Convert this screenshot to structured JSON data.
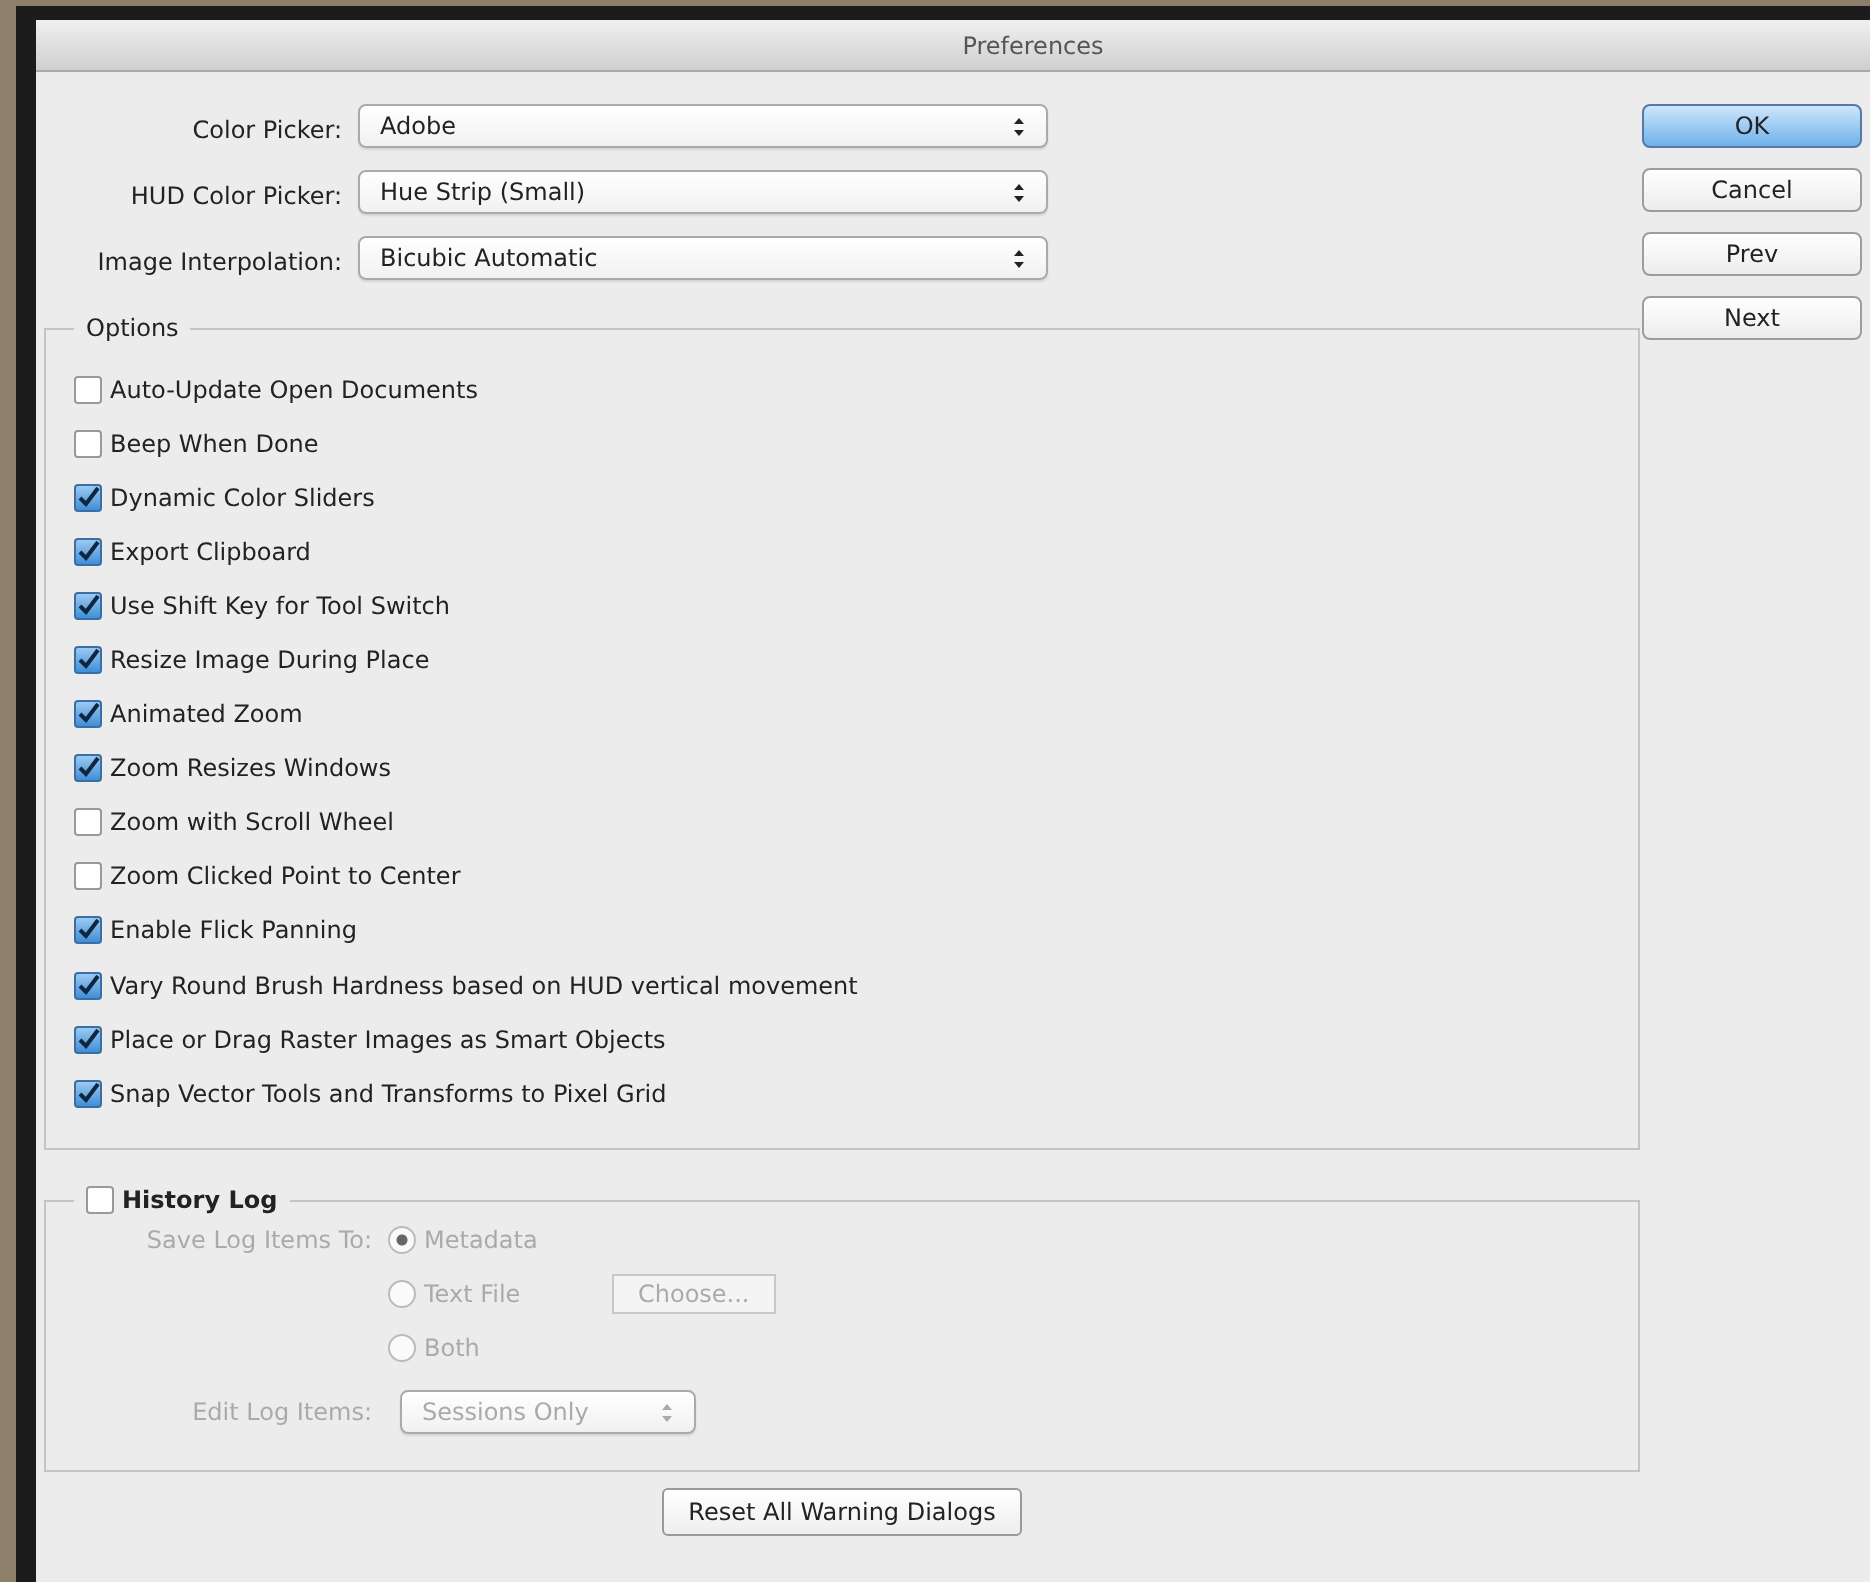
{
  "window": {
    "title": "Preferences"
  },
  "general": [
    {
      "label": "Color Picker:",
      "value": "Adobe"
    },
    {
      "label": "HUD Color Picker:",
      "value": "Hue Strip (Small)"
    },
    {
      "label": "Image Interpolation:",
      "value": "Bicubic Automatic"
    }
  ],
  "options": {
    "title": "Options",
    "items": [
      {
        "label": "Auto-Update Open Documents",
        "checked": false
      },
      {
        "label": "Beep When Done",
        "checked": false
      },
      {
        "label": "Dynamic Color Sliders",
        "checked": true
      },
      {
        "label": "Export Clipboard",
        "checked": true
      },
      {
        "label": "Use Shift Key for Tool Switch",
        "checked": true
      },
      {
        "label": "Resize Image During Place",
        "checked": true
      },
      {
        "label": "Animated Zoom",
        "checked": true
      },
      {
        "label": "Zoom Resizes Windows",
        "checked": true
      },
      {
        "label": "Zoom with Scroll Wheel",
        "checked": false
      },
      {
        "label": "Zoom Clicked Point to Center",
        "checked": false
      },
      {
        "label": "Enable Flick Panning",
        "checked": true
      },
      {
        "label": "Vary Round Brush Hardness based on HUD vertical movement",
        "checked": true
      },
      {
        "label": "Place or Drag Raster Images as Smart Objects",
        "checked": true
      },
      {
        "label": "Snap Vector Tools and Transforms to Pixel Grid",
        "checked": true
      }
    ]
  },
  "history_log": {
    "title": "History Log",
    "checked": false,
    "disabled": true,
    "save_label": "Save Log Items To:",
    "destinations": [
      {
        "label": "Metadata",
        "selected": true
      },
      {
        "label": "Text File",
        "selected": false
      },
      {
        "label": "Both",
        "selected": false
      }
    ],
    "choose_button": "Choose...",
    "edit_label": "Edit Log Items:",
    "edit_value": "Sessions Only"
  },
  "reset_button": "Reset All Warning Dialogs",
  "buttons": [
    {
      "label": "OK",
      "default": true
    },
    {
      "label": "Cancel",
      "default": false
    },
    {
      "label": "Prev",
      "default": false
    },
    {
      "label": "Next",
      "default": false
    }
  ]
}
